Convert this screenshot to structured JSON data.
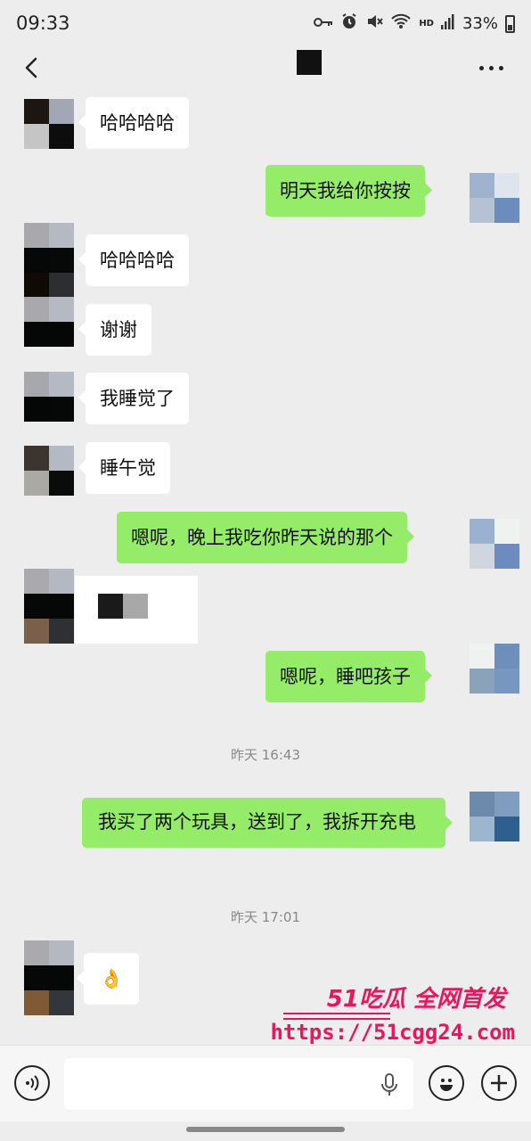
{
  "status_bar": {
    "time": "09:33",
    "network_label": "HD",
    "battery": "33%"
  },
  "nav": {
    "back_icon": "chevron-left-icon",
    "more_icon": "more-dots-icon"
  },
  "messages": [
    {
      "side": "left",
      "text": "哈哈哈哈"
    },
    {
      "side": "right",
      "text": "明天我给你按按"
    },
    {
      "side": "left",
      "text": "哈哈哈哈"
    },
    {
      "side": "left",
      "text": "谢谢"
    },
    {
      "side": "left",
      "text": "我睡觉了"
    },
    {
      "side": "left",
      "text": "睡午觉"
    },
    {
      "side": "right",
      "text": "嗯呢，晚上我吃你昨天说的那个"
    },
    {
      "side": "left",
      "text": "",
      "type": "sticker"
    },
    {
      "side": "right",
      "text": "嗯呢，睡吧孩子"
    },
    {
      "type": "timestamp",
      "text": "昨天 16:43"
    },
    {
      "side": "right",
      "text": "我买了两个玩具，送到了，我拆开充电"
    },
    {
      "type": "timestamp",
      "text": "昨天 17:01"
    },
    {
      "side": "left",
      "text": "👌"
    }
  ],
  "watermark": {
    "brand": "51吃瓜 全网首发",
    "url": "https://51cgg24.com"
  },
  "input_bar": {
    "voice_icon": "voice-icon",
    "mic_icon": "mic-icon",
    "emoji_icon": "emoji-icon",
    "plus_icon": "plus-icon",
    "placeholder": ""
  },
  "colors": {
    "background": "#ededed",
    "bubble_self": "#95ec69",
    "bubble_other": "#ffffff",
    "watermark": "#e8175d"
  }
}
